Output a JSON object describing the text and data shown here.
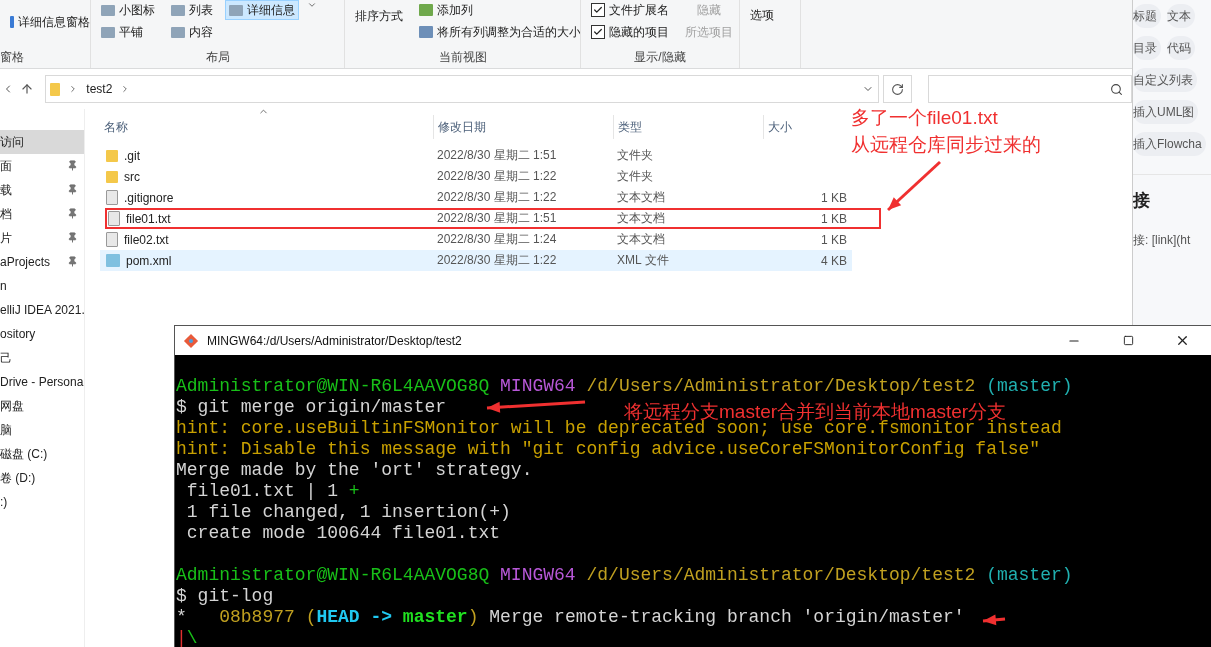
{
  "ribbon": {
    "pane": {
      "button": "详细信息窗格",
      "label": "窗格"
    },
    "layout": {
      "label": "布局",
      "options": [
        {
          "label": "小图标",
          "selected": false
        },
        {
          "label": "列表",
          "selected": false
        },
        {
          "label": "详细信息",
          "selected": true
        },
        {
          "label": "平铺",
          "selected": false
        },
        {
          "label": "内容",
          "selected": false
        }
      ]
    },
    "current_view": {
      "label": "当前视图",
      "sort": "排序方式",
      "add_column": "添加列",
      "fit_columns": "将所有列调整为合适的大小"
    },
    "show_hide": {
      "label": "显示/隐藏",
      "checkboxes": [
        {
          "label": "文件扩展名",
          "checked": true
        },
        {
          "label": "隐藏的项目",
          "checked": true
        }
      ],
      "hide_selected": {
        "lines": [
          "隐藏",
          "所选项目"
        ],
        "disabled": true
      }
    },
    "options": "选项"
  },
  "address": {
    "path": [
      "test2"
    ]
  },
  "sidebar": {
    "items": [
      {
        "label": "访问",
        "selected": true,
        "pinned": false
      },
      {
        "label": "面",
        "selected": false,
        "pinned": true
      },
      {
        "label": "载",
        "selected": false,
        "pinned": true
      },
      {
        "label": "档",
        "selected": false,
        "pinned": true
      },
      {
        "label": "片",
        "selected": false,
        "pinned": true
      },
      {
        "label": "aProjects",
        "selected": false,
        "pinned": true
      },
      {
        "label": "n",
        "selected": false,
        "pinned": false
      },
      {
        "label": "elliJ IDEA 2021.",
        "selected": false,
        "pinned": false
      },
      {
        "label": "ository",
        "selected": false,
        "pinned": false
      },
      {
        "label": "己",
        "selected": false,
        "pinned": false
      },
      {
        "label": "Drive - Persona",
        "selected": false,
        "pinned": false
      },
      {
        "label": "网盘",
        "selected": false,
        "pinned": false
      },
      {
        "label": "脑",
        "selected": false,
        "pinned": false
      },
      {
        "label": "磁盘 (C:)",
        "selected": false,
        "pinned": false
      },
      {
        "label": "卷 (D:)",
        "selected": false,
        "pinned": false
      },
      {
        "label": ":)",
        "selected": false,
        "pinned": false
      }
    ]
  },
  "files": {
    "columns": [
      "名称",
      "修改日期",
      "类型",
      "大小"
    ],
    "rows": [
      {
        "kind": "folder",
        "name": ".git",
        "modified": "2022/8/30 星期二 1:51",
        "type": "文件夹",
        "selected": false,
        "marked": false
      },
      {
        "kind": "folder",
        "name": "src",
        "modified": "2022/8/30 星期二 1:22",
        "type": "文件夹",
        "selected": false,
        "marked": false
      },
      {
        "kind": "text",
        "name": ".gitignore",
        "modified": "2022/8/30 星期二 1:22",
        "type": "文本文档",
        "size": "1 KB",
        "selected": false,
        "marked": false
      },
      {
        "kind": "text",
        "name": "file01.txt",
        "modified": "2022/8/30 星期二 1:51",
        "type": "文本文档",
        "size": "1 KB",
        "selected": false,
        "marked": true
      },
      {
        "kind": "text",
        "name": "file02.txt",
        "modified": "2022/8/30 星期二 1:24",
        "type": "文本文档",
        "size": "1 KB",
        "selected": false,
        "marked": false
      },
      {
        "kind": "xml",
        "name": "pom.xml",
        "modified": "2022/8/30 星期二 1:22",
        "type": "XML 文件",
        "size": "4 KB",
        "selected": true,
        "marked": false
      }
    ]
  },
  "callout": {
    "lines": [
      "多了一个file01.txt",
      "从远程仓库同步过来的"
    ]
  },
  "editor_panel": {
    "chip_rows": [
      [
        "标题",
        "文本"
      ],
      [
        "目录",
        "代码"
      ],
      [
        "自定义列表"
      ],
      [
        "插入UML图"
      ],
      [
        "插入Flowcha"
      ]
    ],
    "heading": "接",
    "text": "接: [link](ht"
  },
  "terminal": {
    "title": "MINGW64:/d/Users/Administrator/Desktop/test2",
    "annotation": "将远程分支master合并到当前本地master分支",
    "blocks": [
      {
        "lines": [
          [
            {
              "kind": "user",
              "text": "Administrator@WIN-R6L4AAVOG8Q "
            },
            {
              "kind": "shell",
              "text": "MINGW64 "
            },
            {
              "kind": "path",
              "text": "/d/Users/Administrator/Desktop/test2 "
            },
            {
              "kind": "branch",
              "text": "(master)"
            }
          ],
          [
            {
              "kind": "plain",
              "text": "$ git merge origin/master"
            }
          ],
          [
            {
              "kind": "hint",
              "text": "hint: core.useBuiltinFSMonitor will be deprecated soon; use core.fsmonitor instead"
            }
          ],
          [
            {
              "kind": "hint",
              "text": "hint: Disable this message with \"git config advice.useCoreFSMonitorConfig false\""
            }
          ],
          [
            {
              "kind": "plain",
              "text": "Merge made by the 'ort' strategy."
            }
          ],
          [
            {
              "kind": "plain",
              "text": " file01.txt | 1 "
            },
            {
              "kind": "added",
              "text": "+"
            }
          ],
          [
            {
              "kind": "plain",
              "text": " 1 file changed, 1 insertion(+)"
            }
          ],
          [
            {
              "kind": "plain",
              "text": " create mode 100644 file01.txt"
            }
          ]
        ]
      },
      {
        "lines": [
          [
            {
              "kind": "user",
              "text": "Administrator@WIN-R6L4AAVOG8Q "
            },
            {
              "kind": "shell",
              "text": "MINGW64 "
            },
            {
              "kind": "path",
              "text": "/d/Users/Administrator/Desktop/test2 "
            },
            {
              "kind": "branch",
              "text": "(master)"
            }
          ],
          [
            {
              "kind": "plain",
              "text": "$ git-log"
            }
          ],
          [
            {
              "kind": "plain",
              "text": "*   "
            },
            {
              "kind": "hash",
              "text": "08b8977 ("
            },
            {
              "kind": "head",
              "text": "HEAD -> "
            },
            {
              "kind": "local",
              "text": "master"
            },
            {
              "kind": "hash",
              "text": ")"
            },
            {
              "kind": "plain",
              "text": " Merge remote-tracking branch 'origin/master'"
            }
          ],
          [
            {
              "kind": "graph_red",
              "text": "|"
            },
            {
              "kind": "graph_green",
              "text": "\\"
            }
          ]
        ]
      }
    ]
  }
}
